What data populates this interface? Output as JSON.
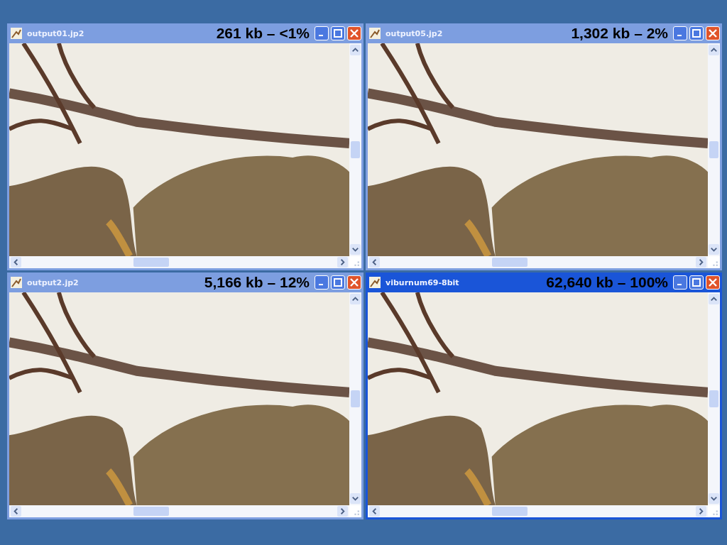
{
  "windows": [
    {
      "title": "output01.jp2",
      "caption": "261 kb – <1%",
      "active": false
    },
    {
      "title": "output05.jp2",
      "caption": "1,302 kb – 2%",
      "active": false
    },
    {
      "title": "output2.jp2",
      "caption": "5,166 kb – 12%",
      "active": false
    },
    {
      "title": "viburnum69-8bit",
      "caption": "62,640 kb – 100%",
      "active": true
    }
  ]
}
